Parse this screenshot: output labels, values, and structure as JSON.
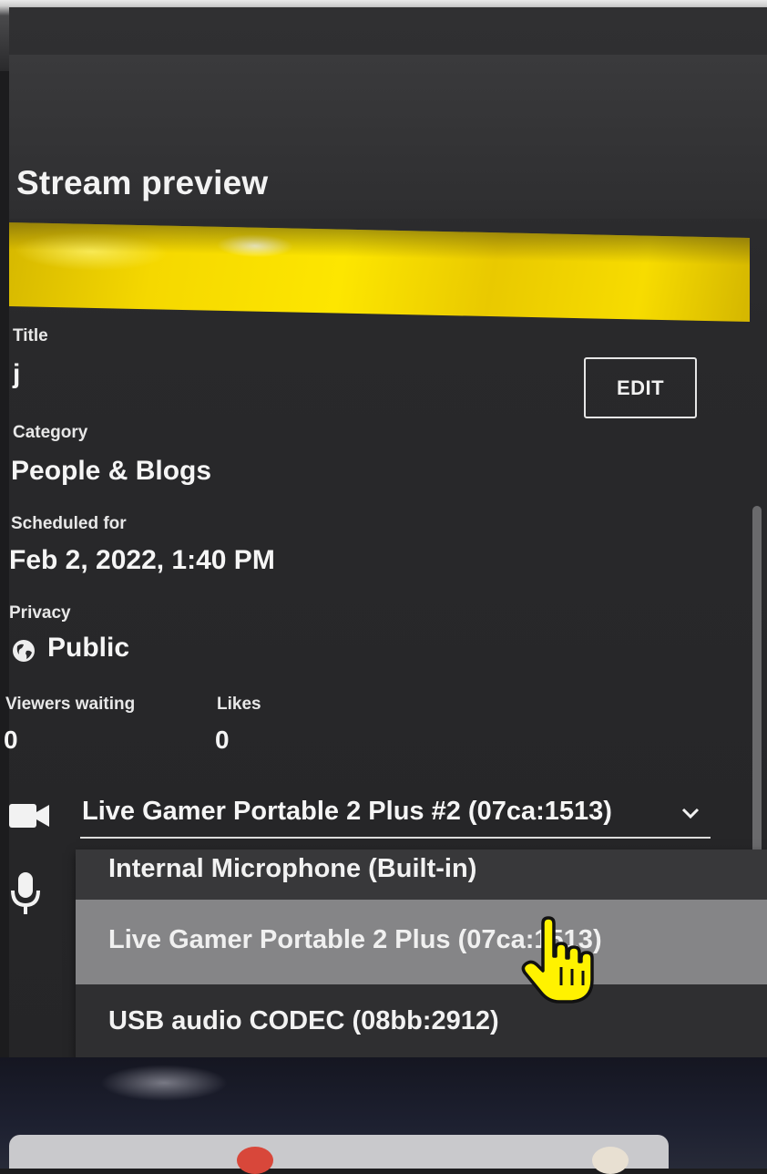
{
  "panel": {
    "title": "Stream preview"
  },
  "stream": {
    "title_label": "Title",
    "title_value": "j",
    "edit_label": "EDIT",
    "category_label": "Category",
    "category_value": "People & Blogs",
    "scheduled_label": "Scheduled for",
    "scheduled_value": "Feb 2, 2022, 1:40 PM",
    "privacy_label": "Privacy",
    "privacy_value": "Public",
    "privacy_icon": "globe-icon",
    "viewers_label": "Viewers waiting",
    "viewers_value": "0",
    "likes_label": "Likes",
    "likes_value": "0"
  },
  "devices": {
    "camera_icon": "video-camera-icon",
    "mic_icon": "microphone-icon",
    "camera_selected": "Live Gamer Portable 2 Plus #2 (07ca:1513)",
    "mic_options": [
      "Internal Microphone (Built-in)",
      "Live Gamer Portable 2 Plus (07ca:1513)",
      "USB audio CODEC (08bb:2912)"
    ],
    "hovered_option_index": 1
  },
  "colors": {
    "preview_accent": "#f5d800",
    "panel_bg": "#2a2a2c",
    "hover_bg": "#858587",
    "cursor_fill": "#fff200"
  }
}
